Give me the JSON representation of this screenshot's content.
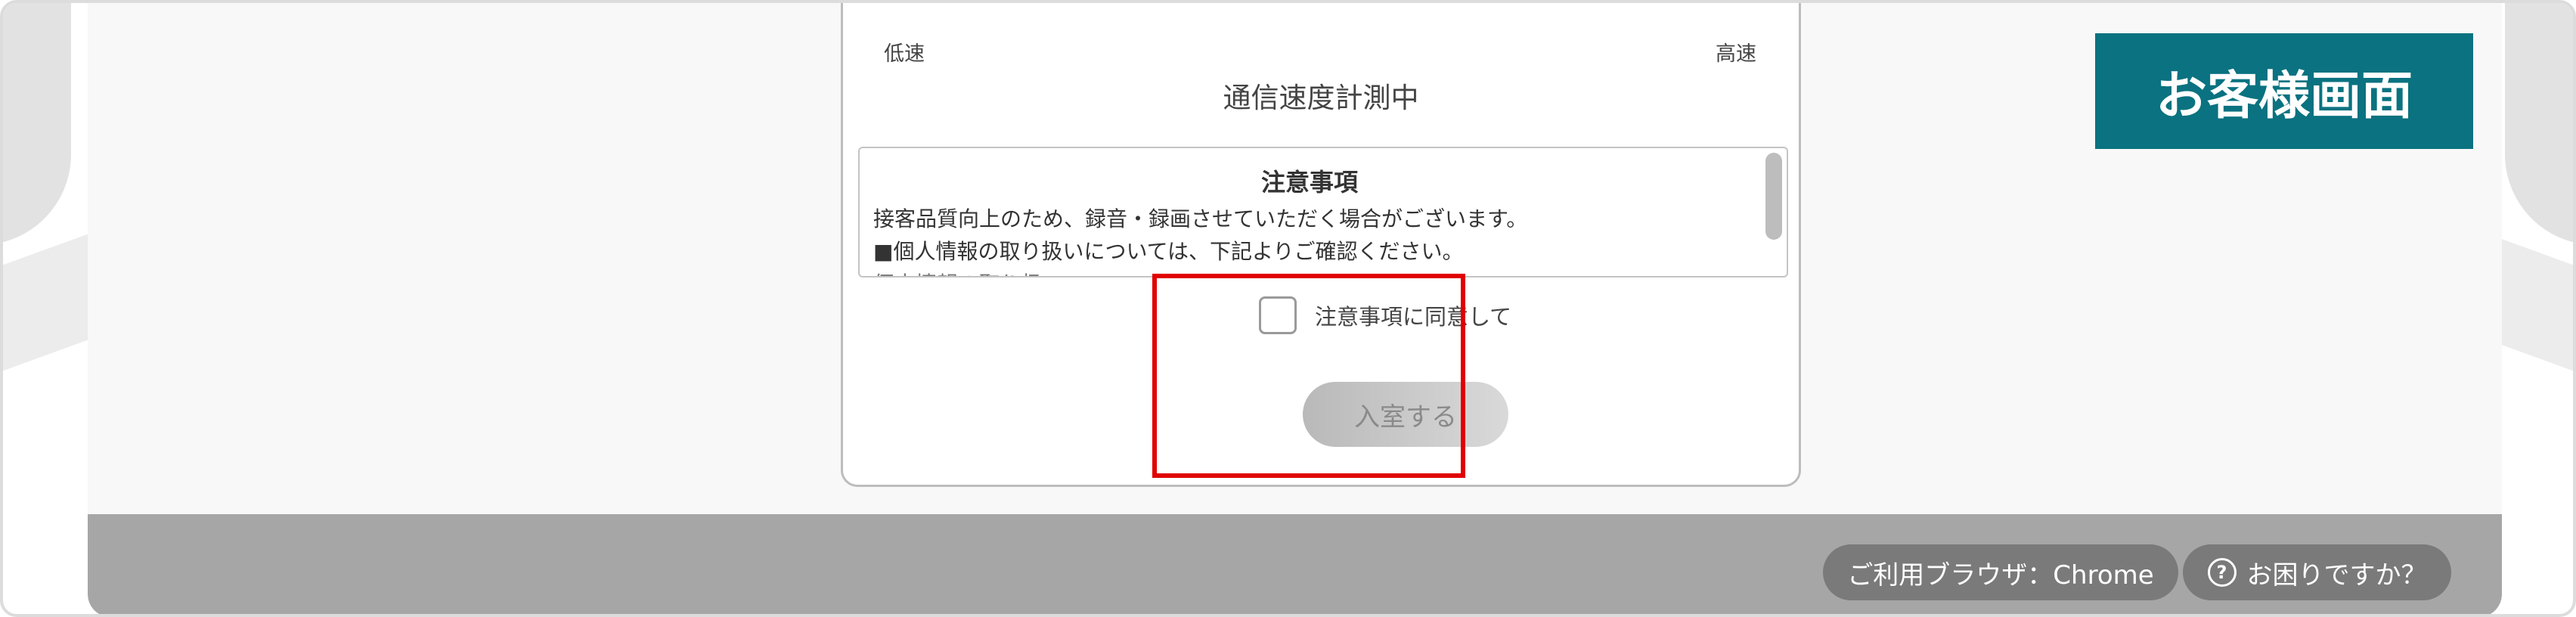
{
  "card": {
    "speed_low": "低速",
    "speed_high": "高速",
    "status": "通信速度計測中"
  },
  "notice": {
    "title": "注意事項",
    "lines": [
      "接客品質向上のため、録音・録画させていただく場合がございます。",
      "■個人情報の取り扱いについては、下記よりご確認ください。",
      "個人情報の取り扱い"
    ]
  },
  "consent": {
    "label": "注意事項に同意して",
    "checked": false
  },
  "enter_button": {
    "label": "入室する",
    "enabled": false
  },
  "badge": {
    "label": "お客様画面",
    "color": "#0a7280"
  },
  "footer": {
    "browser": "ご利用ブラウザ：Chrome",
    "help": "お困りですか？",
    "help_icon": "question-circle-icon"
  },
  "highlight_color": "#e00000"
}
